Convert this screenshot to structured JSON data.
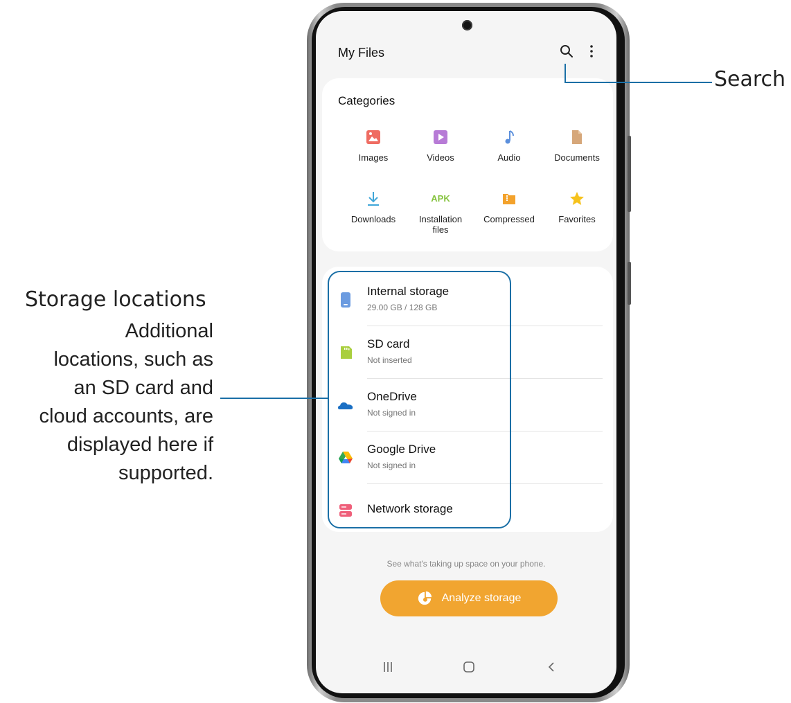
{
  "app": {
    "title": "My Files"
  },
  "toolbar": {
    "search_icon": "search-icon",
    "more_icon": "more-vert-icon"
  },
  "categories": {
    "title": "Categories",
    "items": [
      {
        "label": "Images",
        "icon": "image-icon",
        "color": "#ef6c62"
      },
      {
        "label": "Videos",
        "icon": "video-icon",
        "color": "#b77bd6"
      },
      {
        "label": "Audio",
        "icon": "music-note-icon",
        "color": "#5b8fdc"
      },
      {
        "label": "Documents",
        "icon": "document-icon",
        "color": "#d6a77a"
      },
      {
        "label": "Downloads",
        "icon": "download-icon",
        "color": "#3fa6d8"
      },
      {
        "label": "Installation files",
        "icon": "apk-icon",
        "icon_text": "APK",
        "color": "#86c33f"
      },
      {
        "label": "Compressed",
        "icon": "zip-folder-icon",
        "color": "#f3a22c"
      },
      {
        "label": "Favorites",
        "icon": "star-icon",
        "color": "#f6c21c"
      }
    ]
  },
  "storage": {
    "items": [
      {
        "name": "Internal storage",
        "sub": "29.00 GB / 128 GB",
        "icon": "phone-storage-icon",
        "color": "#6b9be0"
      },
      {
        "name": "SD card",
        "sub": "Not inserted",
        "icon": "sd-card-icon",
        "color": "#a9cf3e"
      },
      {
        "name": "OneDrive",
        "sub": "Not signed in",
        "icon": "onedrive-icon",
        "color": "#1a6fc4"
      },
      {
        "name": "Google Drive",
        "sub": "Not signed in",
        "icon": "google-drive-icon",
        "color": "#34a853"
      },
      {
        "name": "Network storage",
        "sub": "",
        "icon": "network-storage-icon",
        "color": "#ef5f7a"
      }
    ]
  },
  "analyze": {
    "hint": "See what's taking up space on your phone.",
    "button_label": "Analyze storage",
    "color": "#f1a530"
  },
  "nav": {
    "recents": "recents-icon",
    "home": "home-icon",
    "back": "back-icon"
  },
  "callouts": {
    "search": {
      "title": "Search"
    },
    "storage": {
      "title": "Storage locations",
      "desc_lines": [
        "Additional",
        "locations, such as",
        "an SD card and",
        "cloud accounts, are",
        "displayed here if",
        "supported."
      ]
    }
  },
  "accent_color": "#1a6fa6"
}
